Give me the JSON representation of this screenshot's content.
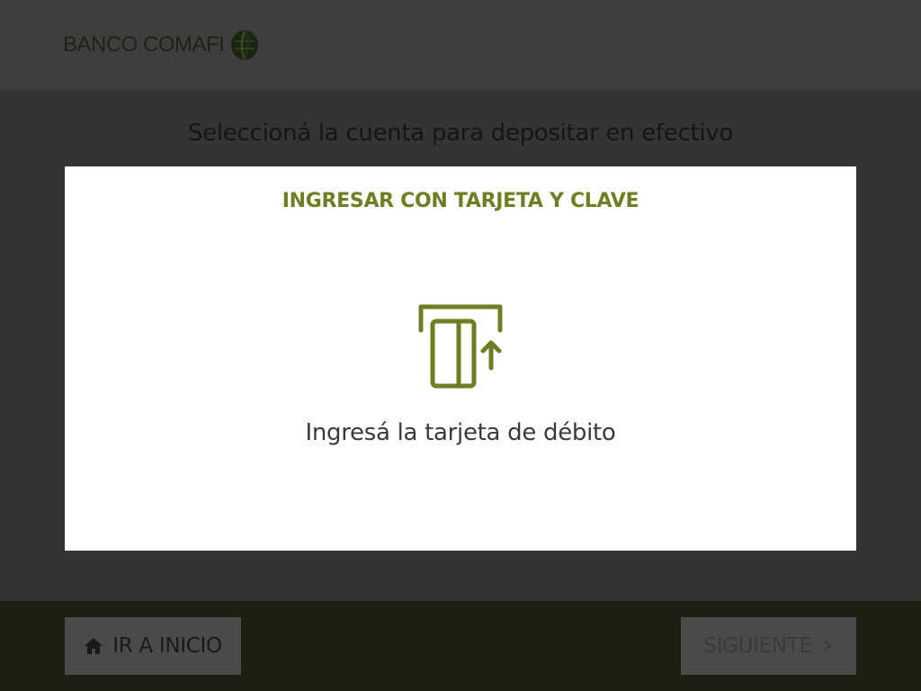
{
  "header": {
    "logo_text": "BANCO COMAFI",
    "logo_icon": "comafi-leaf-icon"
  },
  "main": {
    "title": "Seleccioná la cuenta para depositar en efectivo"
  },
  "modal": {
    "title": "INGRESAR CON TARJETA Y CLAVE",
    "icon": "card-insert-icon",
    "instruction": "Ingresá la tarjeta de débito"
  },
  "footer": {
    "home_label": "IR A INICIO",
    "home_icon": "home-icon",
    "next_label": "SIGUIENTE",
    "next_icon": "chevron-right-icon",
    "next_enabled": false
  },
  "colors": {
    "accent": "#6e7e22",
    "overlay": "#343434",
    "footer_bg": "#1b1e11",
    "modal_bg": "#ffffff"
  }
}
